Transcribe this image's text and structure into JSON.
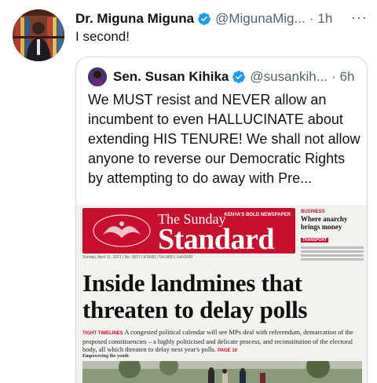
{
  "tweet": {
    "author_name": "Dr. Miguna Miguna",
    "author_handle": "@MigunaMig...",
    "separator": "·",
    "time": "1h",
    "more_label": "···",
    "text": "I second!"
  },
  "quoted": {
    "author_name": "Sen. Susan Kihika",
    "author_handle": "@susankih...",
    "separator": "·",
    "time": "6h",
    "text": "We MUST resist and NEVER allow an incumbent to even HALLUCINATE about extending HIS TENURE!  We shall not allow anyone to reverse our Democratic Rights by attempting to do away with Pre..."
  },
  "newspaper": {
    "masthead_the": "The Sunday",
    "masthead_name": "Standard",
    "masthead_tag": "KENYA'S BOLD NEWSPAPER",
    "date_line": "Sunday, April 11, 2021 | No. 9017 | KSh60 | Tsh1800 | Ush3200",
    "side_kicker": "BUSINESS",
    "side_title": "Where anarchy brings money",
    "side_red": "TRANSPORT",
    "headline": "Inside landmines that threaten to delay polls",
    "lede_tag": "TIGHT TIMELINES",
    "lede": "A congested political calendar will see MPs deal with referendum, demarcation of the proposed constituencies – a highly politicised and delicate process, and reconstitution of the electoral body, all which threaten to delay next year's polls.",
    "lede_page": "PAGE 10",
    "strip_label": "Empowering the youth"
  },
  "colors": {
    "verified": "#1d9bf0",
    "masthead_red": "#c8102e",
    "secondary_text": "#536471",
    "border": "#cfd9de"
  },
  "icons": {
    "verified": "verified-badge-icon",
    "more": "more-options-icon"
  }
}
